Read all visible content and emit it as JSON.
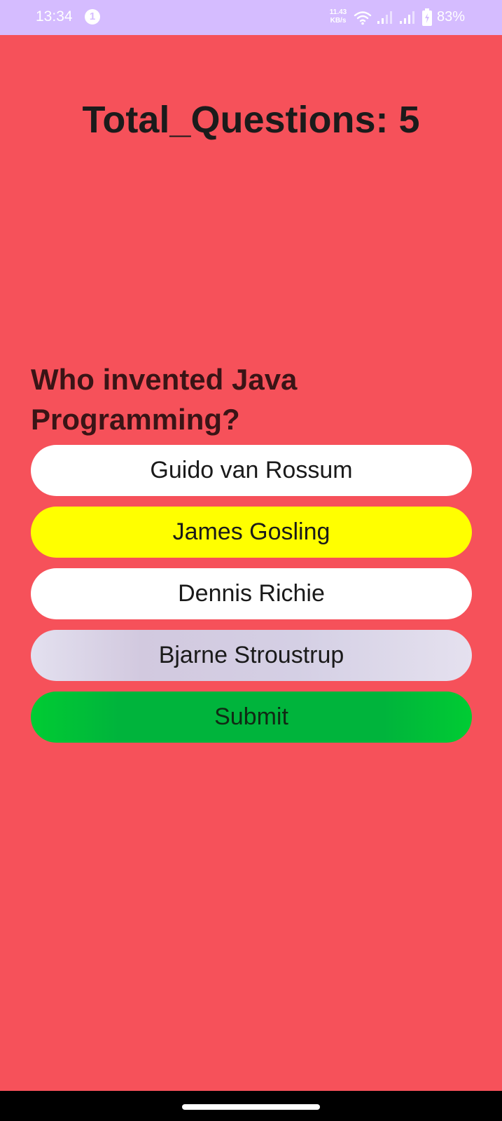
{
  "status_bar": {
    "time": "13:34",
    "notification_count": "1",
    "net_speed_value": "11.43",
    "net_speed_unit": "KB/s",
    "battery": "83%"
  },
  "quiz": {
    "total_questions_label": "Total_Questions: 5",
    "question": "Who invented Java Programming?",
    "options": [
      {
        "label": "Guido van Rossum",
        "color": "#ffffff"
      },
      {
        "label": "James Gosling",
        "color": "#ffff00",
        "selected": true
      },
      {
        "label": "Dennis Richie",
        "color": "#ffffff"
      },
      {
        "label": "Bjarne Stroustrup",
        "color": "#d4cfe4"
      }
    ],
    "submit_label": "Submit"
  },
  "colors": {
    "background": "#f6515a",
    "status_bar": "#d5bcff",
    "submit": "#00b43c",
    "selected_option": "#ffff00"
  }
}
